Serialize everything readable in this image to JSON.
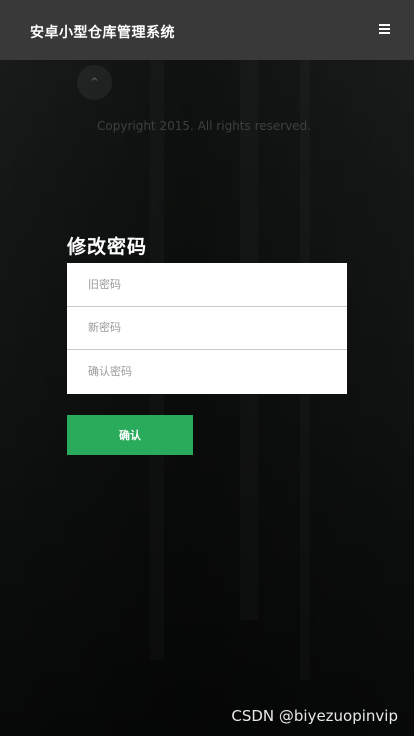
{
  "header": {
    "title": "安卓小型仓库管理系统",
    "menu_icon": "hamburger-menu-icon"
  },
  "scroll_top": {
    "icon": "chevron-up-icon",
    "glyph": "^"
  },
  "footer": {
    "copyright": "Copyright 2015. All rights reserved."
  },
  "form": {
    "title": "修改密码",
    "old_password_placeholder": "旧密码",
    "new_password_placeholder": "新密码",
    "confirm_password_placeholder": "确认密码",
    "submit_label": "确认"
  },
  "watermark": "CSDN @biyezuopinvip",
  "colors": {
    "header_bg": "#393939",
    "button_green": "#2aab5c"
  }
}
